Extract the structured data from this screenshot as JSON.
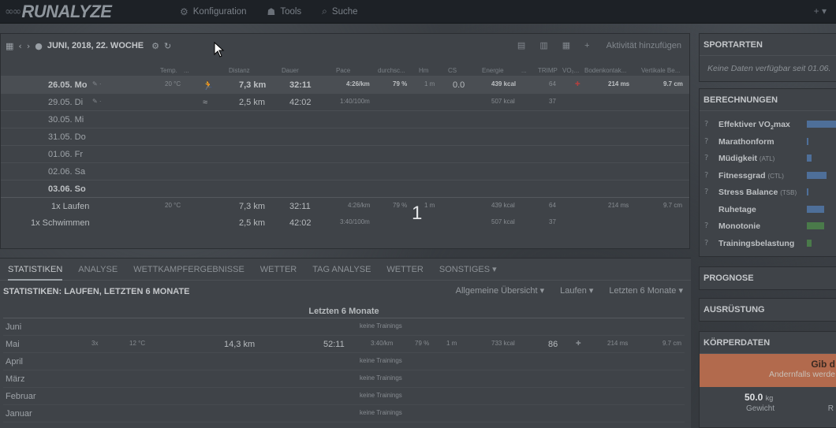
{
  "topbar": {
    "logo": "RUNALYZE",
    "nav": [
      {
        "icon": "gear-icon",
        "glyph": "⚙",
        "label": "Konfiguration"
      },
      {
        "icon": "tools-icon",
        "glyph": "☗",
        "label": "Tools"
      },
      {
        "icon": "search-icon",
        "glyph": "⌕",
        "label": "Suche"
      }
    ],
    "add": "+ ▾"
  },
  "calendar": {
    "title": "JUNI, 2018, 22. WOCHE",
    "add_activity": "Aktivität hinzufügen",
    "columns": [
      "Temp.",
      "...",
      "Distanz",
      "Dauer",
      "Pace",
      "durchsc...",
      "Hm",
      "CS",
      "Energie",
      "...",
      "TRIMP",
      "VO₂...",
      "Bodenkontak...",
      "Vertikale Be..."
    ],
    "days": [
      {
        "day": "26.05. Mo",
        "temp": "20 °C",
        "dist": "7,3 km",
        "dur": "32:11",
        "pace": "4:26/km",
        "hf": "79 %",
        "hm": "1 m",
        "cs": "0.0",
        "energy": "439 kcal",
        "trimp": "64",
        "gct": "214 ms",
        "vo": "9.7 cm",
        "sport": "run"
      },
      {
        "day": "29.05. Di",
        "dist": "2,5 km",
        "dur": "42:02",
        "pace": "1:40/100m",
        "energy": "507 kcal",
        "trimp": "37",
        "sport": "swim"
      },
      {
        "day": "30.05. Mi"
      },
      {
        "day": "31.05. Do"
      },
      {
        "day": "01.06. Fr"
      },
      {
        "day": "02.06. Sa"
      },
      {
        "day": "03.06. So"
      }
    ],
    "summary": [
      {
        "label": "1x Laufen",
        "temp": "20 °C",
        "dist": "7,3 km",
        "dur": "32:11",
        "pace": "4:26/km",
        "hf": "79 %",
        "hm": "1 m",
        "energy": "439 kcal",
        "trimp": "64",
        "gct": "214 ms",
        "vo": "9.7 cm"
      },
      {
        "label": "1x Schwimmen",
        "dist": "2,5 km",
        "dur": "42:02",
        "pace": "3:40/100m",
        "energy": "507 kcal",
        "trimp": "37"
      }
    ],
    "overlay_number": "1"
  },
  "tabs": {
    "items": [
      "STATISTIKEN",
      "ANALYSE",
      "WETTKAMPFERGEBNISSE",
      "WETTER",
      "TAG ANALYSE",
      "WETTER",
      "SONSTIGES ▾"
    ],
    "title": "STATISTIKEN: LAUFEN, LETZTEN 6 MONATE",
    "selects": [
      "Allgemeine Übersicht ▾",
      "Laufen ▾",
      "Letzten 6 Monate ▾"
    ],
    "period": "Letzten 6 Monate",
    "months": [
      {
        "m": "Juni",
        "note": "keine Trainings"
      },
      {
        "m": "Mai",
        "count": "3x",
        "temp": "12 °C",
        "dist": "14,3 km",
        "dur": "52:11",
        "pace": "3:40/km",
        "hf": "79 %",
        "hm": "1 m",
        "energy": "733 kcal",
        "trimp": "86",
        "gct": "214 ms",
        "vo": "9.7 cm"
      },
      {
        "m": "April",
        "note": "keine Trainings"
      },
      {
        "m": "März",
        "note": "keine Trainings"
      },
      {
        "m": "Februar",
        "note": "keine Trainings"
      },
      {
        "m": "Januar",
        "note": "keine Trainings"
      }
    ]
  },
  "sidebar": {
    "sportarten": {
      "title": "SPORTARTEN",
      "note": "Keine Daten verfügbar seit 01.06."
    },
    "berechnungen": {
      "title": "BERECHNUNGEN",
      "items": [
        {
          "pre": "Effektiver VO",
          "sub": "2",
          "post": "max",
          "unit": "",
          "level": 0.7,
          "color": "blue"
        },
        {
          "pre": "Marathonform",
          "sub": "",
          "post": "",
          "unit": "",
          "level": 0.02,
          "color": "blue"
        },
        {
          "pre": "Müdigkeit",
          "sub": "",
          "post": "",
          "unit": "(ATL)",
          "level": 0.1,
          "color": "blue"
        },
        {
          "pre": "Fitnessgrad",
          "sub": "",
          "post": "",
          "unit": "(CTL)",
          "level": 0.45,
          "color": "blue"
        },
        {
          "pre": "Stress Balance",
          "sub": "",
          "post": "",
          "unit": "(TSB)",
          "level": 0.0,
          "color": "blue"
        },
        {
          "pre": "Ruhetage",
          "sub": "",
          "post": "",
          "unit": "",
          "level": 0.4,
          "color": "blue"
        },
        {
          "pre": "Monotonie",
          "sub": "",
          "post": "",
          "unit": "",
          "level": 0.4,
          "color": "green"
        },
        {
          "pre": "Trainingsbelastung",
          "sub": "",
          "post": "",
          "unit": "",
          "level": 0.1,
          "color": "green"
        }
      ]
    },
    "prognose": {
      "title": "PROGNOSE"
    },
    "ausruestung": {
      "title": "AUSRÜSTUNG"
    },
    "koerper": {
      "title": "KÖRPERDATEN",
      "warn1": "Gib d",
      "warn2": "Andernfalls werde",
      "weight": "50.0",
      "unit": "kg",
      "weight_label": "Gewicht",
      "r": "R"
    }
  }
}
